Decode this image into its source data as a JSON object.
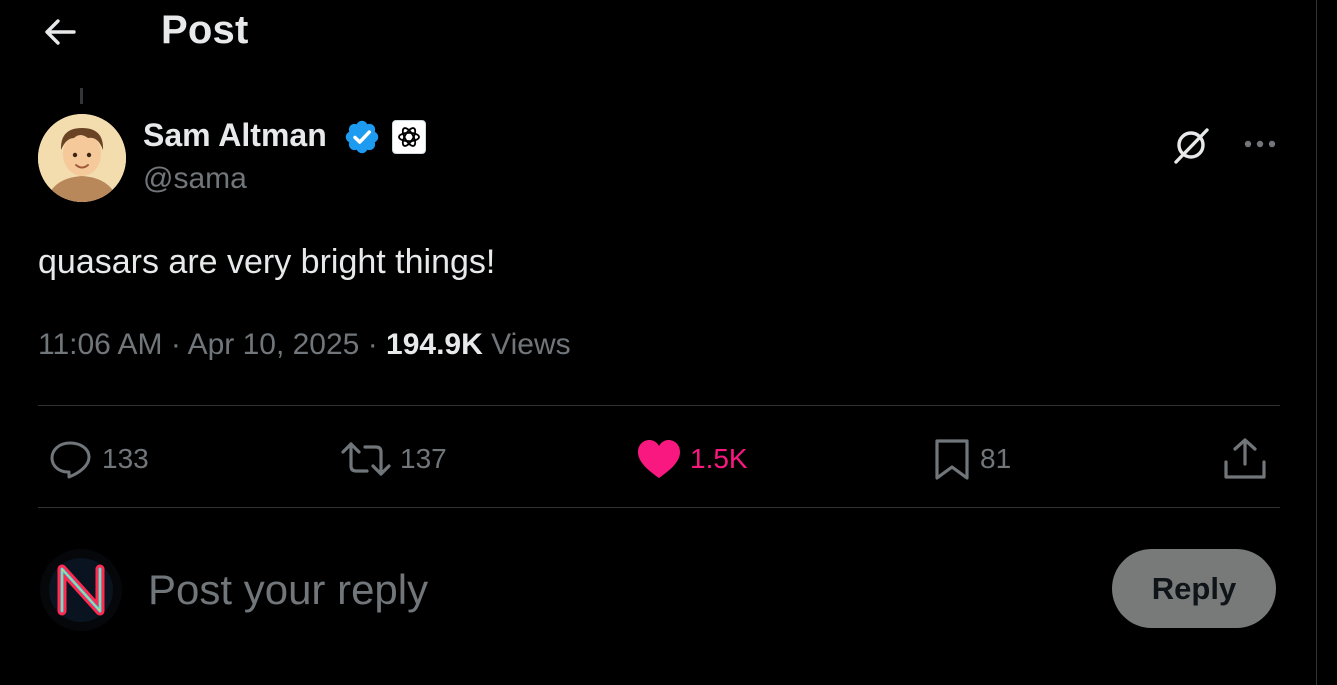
{
  "header": {
    "title": "Post",
    "back_icon": "arrow-left-icon"
  },
  "author": {
    "name": "Sam Altman",
    "handle": "@sama",
    "verified_icon": "verified-badge-icon",
    "affiliate_icon": "openai-logo-icon",
    "avatar_icon": "cartoon-avatar"
  },
  "post": {
    "text": "quasars are very bright things!",
    "time": "11:06 AM",
    "separator1": "·",
    "date": "Apr 10, 2025",
    "separator2": "·",
    "views_count": "194.9K",
    "views_label": "Views"
  },
  "actions": {
    "replies": "133",
    "reposts": "137",
    "likes": "1.5K",
    "bookmarks": "81"
  },
  "composer": {
    "placeholder": "Post your reply",
    "button_label": "Reply"
  },
  "colors": {
    "background": "#000000",
    "text_primary": "#e7e9ea",
    "text_secondary": "#71767b",
    "divider": "#2f3336",
    "like_pink": "#f91880",
    "verified_blue": "#1d9bf0",
    "reply_button_bg": "#787a7a"
  }
}
